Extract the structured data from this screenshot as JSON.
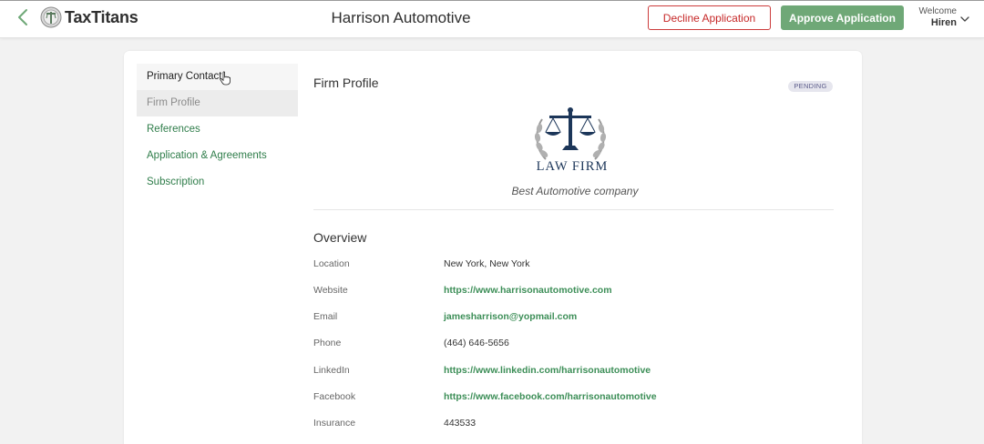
{
  "header": {
    "brand": "TaxTitans",
    "firm_name": "Harrison Automotive",
    "decline_label": "Decline Application",
    "approve_label": "Approve Application",
    "welcome_label": "Welcome",
    "user_name": "Hiren"
  },
  "sidebar": {
    "items": [
      {
        "label": "Primary Contact"
      },
      {
        "label": "Firm Profile"
      },
      {
        "label": "References"
      },
      {
        "label": "Application & Agreements"
      },
      {
        "label": "Subscription"
      }
    ]
  },
  "profile": {
    "title": "Firm Profile",
    "status": "PENDING",
    "logo_text": "LAW FIRM",
    "tagline": "Best Automotive company"
  },
  "overview": {
    "title": "Overview",
    "rows": [
      {
        "label": "Location",
        "value": "New York, New York"
      },
      {
        "label": "Website",
        "value": "https://www.harrisonautomotive.com"
      },
      {
        "label": "Email",
        "value": "jamesharrison@yopmail.com"
      },
      {
        "label": "Phone",
        "value": "(464) 646-5656"
      },
      {
        "label": "LinkedIn",
        "value": "https://www.linkedin.com/harrisonautomotive"
      },
      {
        "label": "Facebook",
        "value": "https://www.facebook.com/harrisonautomotive"
      },
      {
        "label": "Insurance",
        "value": "443533"
      }
    ]
  },
  "colors": {
    "accent_green": "#6fa877",
    "link_green": "#3c8e57",
    "decline_red": "#c62828",
    "logo_navy": "#1c3659"
  },
  "icons": [
    "back-chevron-icon",
    "taxtitans-logo-icon",
    "chevron-down-icon",
    "pointer-cursor-icon",
    "scales-of-justice-icon"
  ]
}
